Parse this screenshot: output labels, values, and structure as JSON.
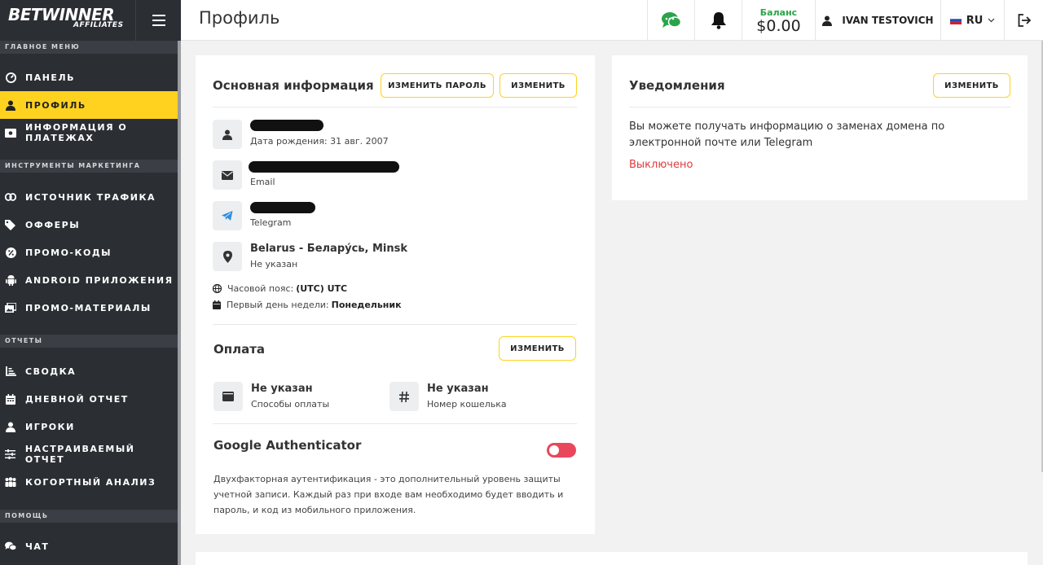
{
  "app": {
    "logo_main": "BETWINNER",
    "logo_sub": "AFFILIATES"
  },
  "sidebar": {
    "sections": [
      {
        "label": "ГЛАВНОЕ МЕНЮ"
      },
      {
        "label": "ИНСТРУМЕНТЫ МАРКЕТИНГА"
      },
      {
        "label": "ОТЧЕТЫ"
      },
      {
        "label": "ПОМОЩЬ"
      }
    ],
    "items": [
      {
        "label": "ПАНЕЛЬ",
        "icon": "dashboard-icon"
      },
      {
        "label": "ПРОФИЛЬ",
        "icon": "user-icon",
        "active": true
      },
      {
        "label": "ИНФОРМАЦИЯ О ПЛАТЕЖАХ",
        "icon": "money-icon"
      },
      {
        "label": "ИСТОЧНИК ТРАФИКА",
        "icon": "link-icon"
      },
      {
        "label": "ОФФЕРЫ",
        "icon": "tags-icon"
      },
      {
        "label": "ПРОМО-КОДЫ",
        "icon": "percent-icon"
      },
      {
        "label": "ANDROID ПРИЛОЖЕНИЯ",
        "icon": "android-icon"
      },
      {
        "label": "ПРОМО-МАТЕРИАЛЫ",
        "icon": "images-icon"
      },
      {
        "label": "СВОДКА",
        "icon": "chart-icon"
      },
      {
        "label": "ДНЕВНОЙ ОТЧЕТ",
        "icon": "calendar-icon"
      },
      {
        "label": "ИГРОКИ",
        "icon": "player-icon"
      },
      {
        "label": "НАСТРАИВАЕМЫЙ ОТЧЕТ",
        "icon": "sliders-icon"
      },
      {
        "label": "КОГОРТНЫЙ АНАЛИЗ",
        "icon": "users-icon"
      },
      {
        "label": "ЧАТ",
        "icon": "chat-icon"
      }
    ]
  },
  "header": {
    "title": "Профиль",
    "balance_label": "Баланс",
    "balance_value": "$0.00",
    "user_name": "IVAN TESTOVICH",
    "language": "RU"
  },
  "basic_info": {
    "title": "Основная информация",
    "change_password_label": "ИЗМЕНИТЬ ПАРОЛЬ",
    "edit_label": "ИЗМЕНИТЬ",
    "birth_label": "Дата рождения: 31 авг. 2007",
    "email_label": "Email",
    "telegram_label": "Telegram",
    "location": "Belarus - Беларýсь, Minsk",
    "location_sub": "Не указан",
    "timezone_label": "Часовой пояс:",
    "timezone_value": "(UTC) UTC",
    "week_label": "Первый день недели:",
    "week_value": "Понедельник"
  },
  "payment": {
    "title": "Оплата",
    "edit_label": "ИЗМЕНИТЬ",
    "method_value": "Не указан",
    "method_label": "Способы оплаты",
    "wallet_value": "Не указан",
    "wallet_label": "Номер кошелька"
  },
  "google_auth": {
    "title": "Google Authenticator",
    "enabled": false,
    "description": "Двухфакторная аутентификация - это дополнительный уровень защиты учетной записи. Каждый раз при входе вам необходимо будет вводить и пароль, и код из мобильного приложения."
  },
  "notifications": {
    "title": "Уведомления",
    "edit_label": "ИЗМЕНИТЬ",
    "description": "Вы можете получать информацию о заменах домена по электронной почте или Telegram",
    "status": "Выключено"
  },
  "colors": {
    "accent": "#ffd21f",
    "sidebar_bg": "#2b2e33",
    "status_off": "#e03a3a",
    "balance_green": "#2aa44a",
    "toggle_off": "#e9475b"
  }
}
